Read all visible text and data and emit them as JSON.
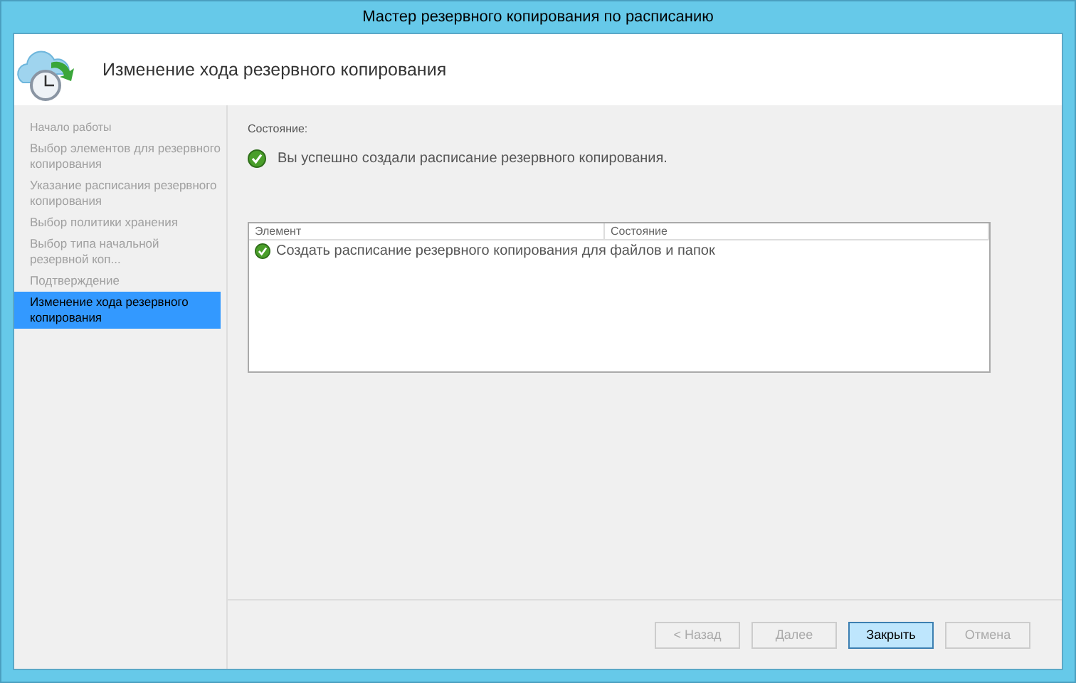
{
  "window": {
    "title": "Мастер резервного копирования по расписанию"
  },
  "header": {
    "title": "Изменение хода резервного копирования"
  },
  "sidebar": {
    "items": [
      {
        "label": "Начало работы",
        "selected": false
      },
      {
        "label": "Выбор элементов для резервного копирования",
        "selected": false
      },
      {
        "label": "Указание расписания резервного копирования",
        "selected": false
      },
      {
        "label": "Выбор политики хранения",
        "selected": false
      },
      {
        "label": "Выбор типа начальной резервной коп...",
        "selected": false
      },
      {
        "label": "Подтверждение",
        "selected": false
      },
      {
        "label": "Изменение хода резервного копирования",
        "selected": true
      }
    ]
  },
  "status": {
    "label": "Состояние:",
    "message": "Вы успешно создали расписание резервного копирования."
  },
  "table": {
    "columns": [
      "Элемент",
      "Состояние"
    ],
    "rows": [
      {
        "item": "Создать расписание резервного копирования для файлов и папок"
      }
    ]
  },
  "buttons": [
    {
      "label": "< Назад",
      "disabled": true,
      "default": false
    },
    {
      "label": "Далее",
      "disabled": true,
      "default": false
    },
    {
      "label": "Закрыть",
      "disabled": false,
      "default": true
    },
    {
      "label": "Отмена",
      "disabled": true,
      "default": false
    }
  ]
}
